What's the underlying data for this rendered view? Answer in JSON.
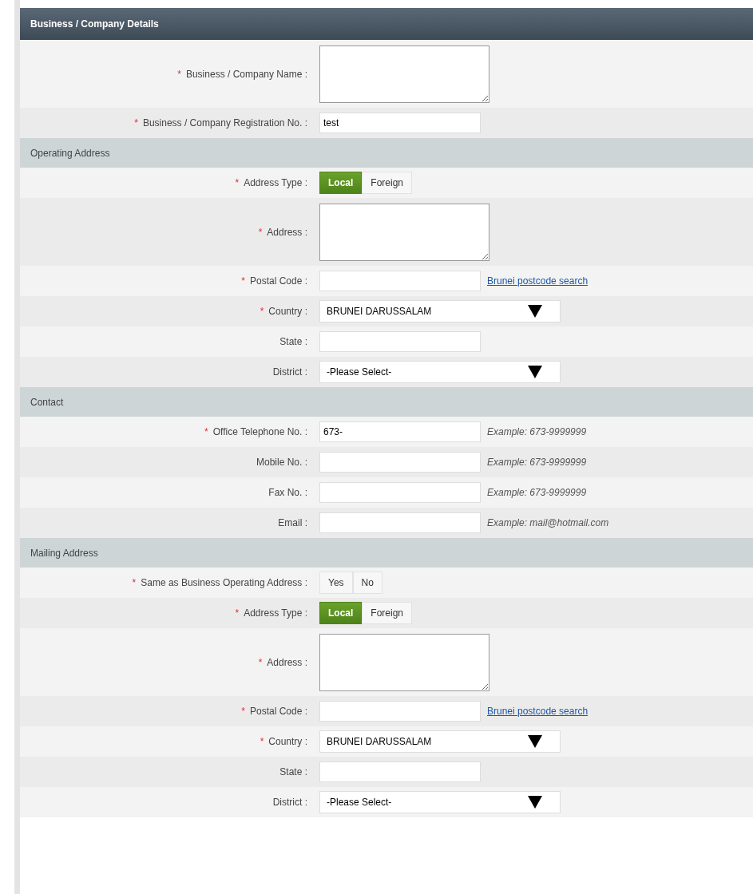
{
  "panel": {
    "title": "Business / Company Details"
  },
  "sections": [
    {
      "fields": [
        {
          "kind": "textarea",
          "required_mark": "*",
          "label": "Business / Company Name :"
        },
        {
          "kind": "text",
          "required_mark": "*",
          "label": "Business / Company Registration No. :",
          "value": "test"
        }
      ]
    },
    {
      "title": "Operating Address",
      "fields": [
        {
          "kind": "toggle",
          "required_mark": "*",
          "label": "Address Type :",
          "options": [
            {
              "label": "Local",
              "selected": true
            },
            {
              "label": "Foreign",
              "selected": false
            }
          ]
        },
        {
          "kind": "textarea",
          "required_mark": "*",
          "label": "Address :"
        },
        {
          "kind": "text",
          "required_mark": "*",
          "label": "Postal Code :",
          "link": "Brunei postcode search"
        },
        {
          "kind": "select",
          "required_mark": "*",
          "label": "Country :",
          "value": "BRUNEI DARUSSALAM"
        },
        {
          "kind": "text",
          "label": "State :"
        },
        {
          "kind": "select",
          "label": "District :",
          "value": "-Please Select-"
        }
      ]
    },
    {
      "title": "Contact",
      "fields": [
        {
          "kind": "text",
          "required_mark": "*",
          "label": "Office Telephone No. :",
          "value": "673-",
          "hint": "Example: 673-9999999"
        },
        {
          "kind": "text",
          "label": "Mobile No. :",
          "hint": "Example: 673-9999999"
        },
        {
          "kind": "text",
          "label": "Fax No. :",
          "hint": "Example: 673-9999999"
        },
        {
          "kind": "text",
          "label": "Email :",
          "hint": "Example: mail@hotmail.com"
        }
      ]
    },
    {
      "title": "Mailing Address",
      "fields": [
        {
          "kind": "toggle",
          "required_mark": "*",
          "label": "Same as Business Operating Address :",
          "options": [
            {
              "label": "Yes",
              "selected": false
            },
            {
              "label": "No",
              "selected": false
            }
          ]
        },
        {
          "kind": "toggle",
          "required_mark": "*",
          "label": "Address Type :",
          "options": [
            {
              "label": "Local",
              "selected": true
            },
            {
              "label": "Foreign",
              "selected": false
            }
          ]
        },
        {
          "kind": "textarea",
          "required_mark": "*",
          "label": "Address :"
        },
        {
          "kind": "text",
          "required_mark": "*",
          "label": "Postal Code :",
          "link": "Brunei postcode search"
        },
        {
          "kind": "select",
          "required_mark": "*",
          "label": "Country :",
          "value": "BRUNEI DARUSSALAM"
        },
        {
          "kind": "text",
          "label": "State :"
        },
        {
          "kind": "select",
          "label": "District :",
          "value": "-Please Select-"
        }
      ]
    }
  ]
}
